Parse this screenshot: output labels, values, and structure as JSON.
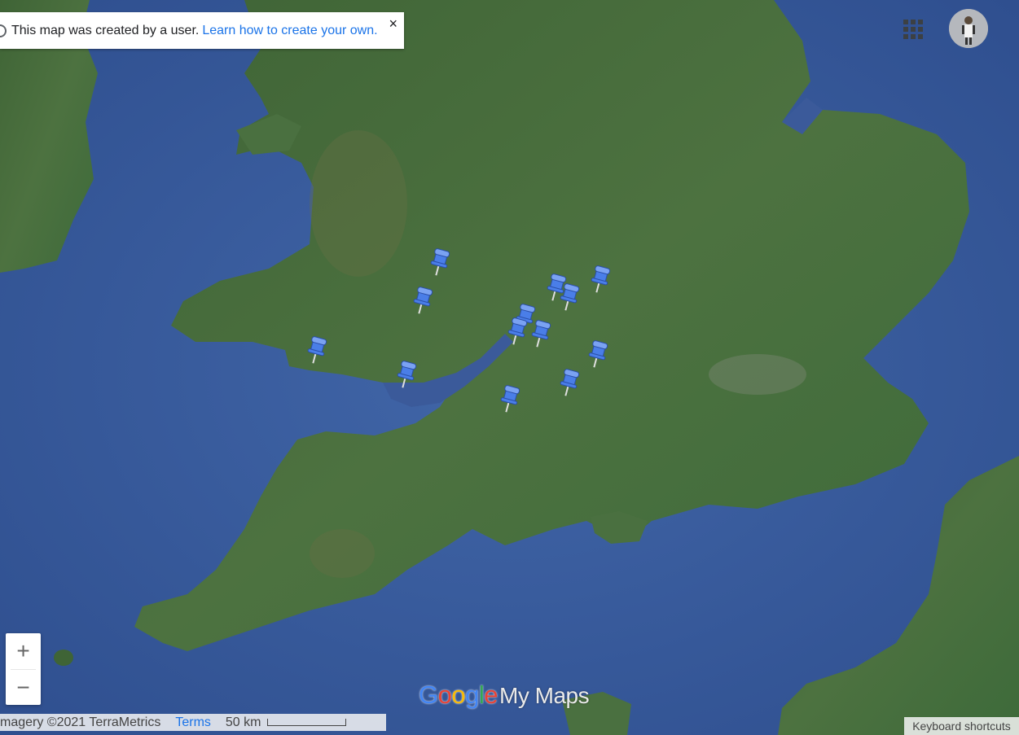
{
  "notice": {
    "text": "This map was created by a user.",
    "link": "Learn how to create your own.",
    "close": "×"
  },
  "zoom": {
    "in": "+",
    "out": "−"
  },
  "logo": {
    "g1": "G",
    "g2": "o",
    "g3": "o",
    "g4": "g",
    "g5": "l",
    "g6": "e",
    "suffix": "My Maps"
  },
  "footer": {
    "imagery": "magery ©2021 TerraMetrics",
    "terms": "Terms",
    "scale": "50 km"
  },
  "keyboard_shortcuts": "Keyboard shortcuts",
  "icons": {
    "apps": "apps-grid-icon",
    "account": "account-avatar",
    "placemark": "blue-pushpin-icon"
  },
  "colors": {
    "sea": "#3b5a9a",
    "land": "#4a6b3c",
    "pin": "#4a7ee8",
    "link": "#1a73e8"
  }
}
